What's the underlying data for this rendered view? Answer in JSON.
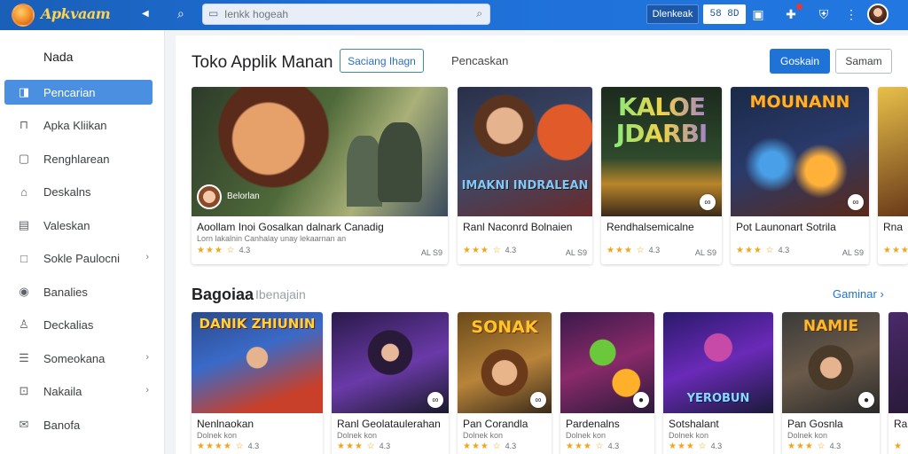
{
  "app": {
    "logo_text": "Apkvaam"
  },
  "search": {
    "placeholder": "Ienkk hogeah"
  },
  "topbar": {
    "button_label": "Dlenkeak",
    "count_label": "58 8D",
    "colors": {
      "bar": "#1e6fd6",
      "logo": "#ffd34d"
    }
  },
  "sidebar": {
    "heading": "Nada",
    "items": [
      {
        "label": "Pencarian",
        "icon": "bookmark-icon",
        "active": true,
        "chevron": false
      },
      {
        "label": "Apka Kliikan",
        "icon": "bag-icon",
        "active": false,
        "chevron": false
      },
      {
        "label": "Renghlarean",
        "icon": "tablet-icon",
        "active": false,
        "chevron": false
      },
      {
        "label": "Deskalns",
        "icon": "home-icon",
        "active": false,
        "chevron": false
      },
      {
        "label": "Valeskan",
        "icon": "browser-icon",
        "active": false,
        "chevron": false
      },
      {
        "label": "Sokle Paulocni",
        "icon": "square-icon",
        "active": false,
        "chevron": true
      },
      {
        "label": "Banalies",
        "icon": "pin-icon",
        "active": false,
        "chevron": false
      },
      {
        "label": "Deckalias",
        "icon": "user-icon",
        "active": false,
        "chevron": false
      },
      {
        "label": "Someokana",
        "icon": "list-icon",
        "active": false,
        "chevron": true
      },
      {
        "label": "Nakaila",
        "icon": "lock-icon",
        "active": false,
        "chevron": true
      },
      {
        "label": "Banofa",
        "icon": "mail-icon",
        "active": false,
        "chevron": false
      }
    ]
  },
  "main": {
    "title": "Toko Applik Manan",
    "tab_active": "Saciang Ihagn",
    "tab_other": "Pencaskan",
    "btn_primary": "Goskain",
    "btn_secondary": "Samam"
  },
  "featured": [
    {
      "title": "Aoollam Inoi Gosalkan dalnark Canadig",
      "sub": "Lorn lakalnin Canhalay unay lekaarnan an",
      "stars": "★★★ ☆",
      "rating": "4.3",
      "meta": "AL S9",
      "art_label": "Belorlan"
    },
    {
      "title": "Ranl Naconrd Bolnaien",
      "sub": "",
      "stars": "★★★ ☆",
      "rating": "4.3",
      "meta": "AL S9",
      "art_label": "IMAKNI INDRALEAN"
    },
    {
      "title": "Rendhalsemicalne",
      "sub": "",
      "stars": "★★★ ☆",
      "rating": "4.3",
      "meta": "AL S9",
      "art_label": "KALOE JDARBI"
    },
    {
      "title": "Pot Launonart Sotrila",
      "sub": "",
      "stars": "★★★ ☆",
      "rating": "4.3",
      "meta": "AL S9",
      "art_label": "MOUNANN"
    },
    {
      "title": "Rna",
      "sub": "",
      "stars": "★★★",
      "rating": "",
      "meta": "",
      "art_label": ""
    }
  ],
  "section": {
    "title": "Bagoiaa",
    "subtitle": "Ibenajain",
    "link": "Gaminar ›"
  },
  "games": [
    {
      "title": "Nenlnaokan",
      "sub": "Dolnek kon",
      "stars": "★★★★ ☆",
      "rating": "4.3",
      "art_label": "DANIK ZHIUNIN"
    },
    {
      "title": "Ranl Geolataulerahan",
      "sub": "Dolnek kon",
      "stars": "★★★ ☆",
      "rating": "4.3",
      "art_label": ""
    },
    {
      "title": "Pan Corandla",
      "sub": "Dolnek kon",
      "stars": "★★★ ☆",
      "rating": "4.3",
      "art_label": "SONAK"
    },
    {
      "title": "Pardenalns",
      "sub": "Dolnek kon",
      "stars": "★★★ ☆",
      "rating": "4.3",
      "art_label": ""
    },
    {
      "title": "Sotshalant",
      "sub": "Dolnek kon",
      "stars": "★★★ ☆",
      "rating": "4.3",
      "art_label": "YEROBUN"
    },
    {
      "title": "Pan Gosnla",
      "sub": "Dolnek kon",
      "stars": "★★★ ☆",
      "rating": "4.3",
      "art_label": "NAMIE"
    },
    {
      "title": "Ran",
      "sub": "",
      "stars": "★",
      "rating": "",
      "art_label": ""
    }
  ]
}
